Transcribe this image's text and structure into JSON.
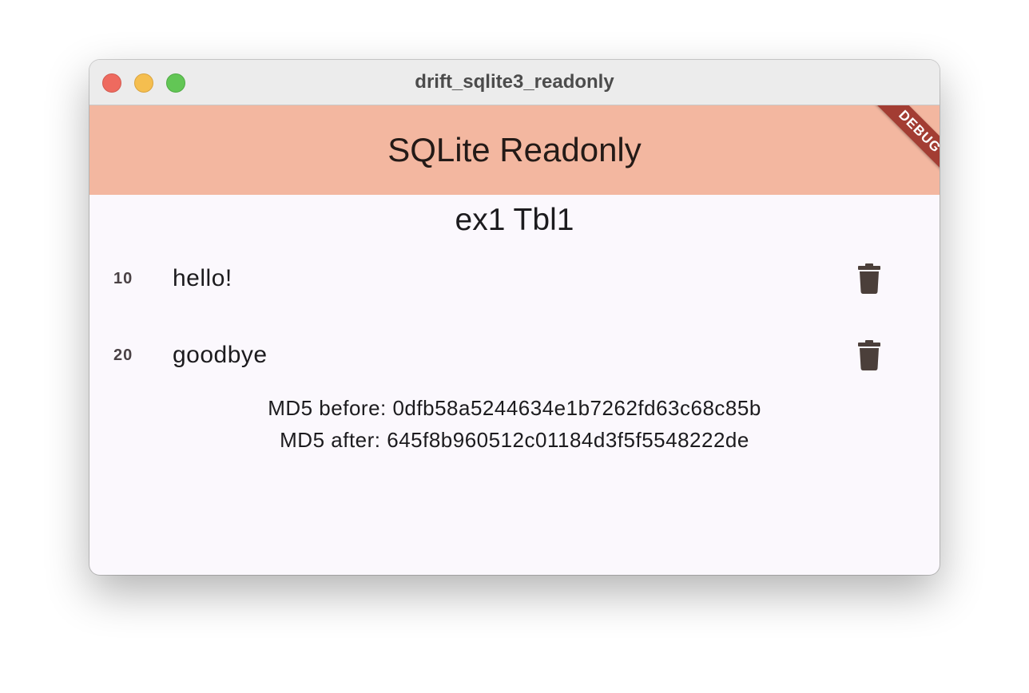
{
  "window": {
    "title": "drift_sqlite3_readonly"
  },
  "appbar": {
    "title": "SQLite Readonly",
    "color": "#f3b7a0"
  },
  "debug_banner": {
    "label": "DEBUG",
    "color": "#a33d33"
  },
  "main": {
    "section_title": "ex1 Tbl1",
    "rows": [
      {
        "id": "10",
        "label": "hello!",
        "action_icon": "trash-icon"
      },
      {
        "id": "20",
        "label": "goodbye",
        "action_icon": "trash-icon"
      }
    ],
    "md5_before": "MD5 before: 0dfb58a5244634e1b7262fd63c68c85b",
    "md5_after": "MD5 after: 645f8b960512c01184d3f5f5548222de"
  }
}
